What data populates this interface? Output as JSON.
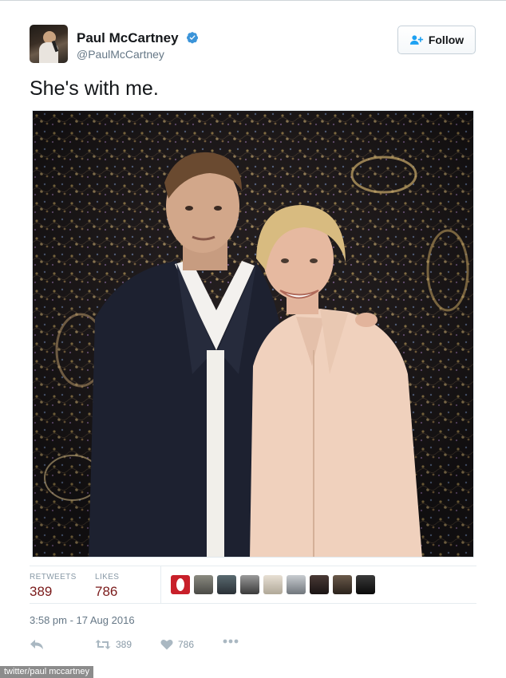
{
  "author": {
    "name": "Paul McCartney",
    "handle": "@PaulMcCartney",
    "verified_icon": "verified-badge-icon",
    "verified_color": "#3b94d9"
  },
  "follow": {
    "label": "Follow",
    "icon": "add-user-icon"
  },
  "tweet": {
    "text": "She's with me."
  },
  "stats": {
    "retweets_label": "RETWEETS",
    "retweets_value": "389",
    "likes_label": "LIKES",
    "likes_value": "786",
    "value_color": "#7a1a1a"
  },
  "likers": [
    {
      "name": "liker-avatar-1"
    },
    {
      "name": "liker-avatar-2"
    },
    {
      "name": "liker-avatar-3"
    },
    {
      "name": "liker-avatar-4"
    },
    {
      "name": "liker-avatar-5"
    },
    {
      "name": "liker-avatar-6"
    },
    {
      "name": "liker-avatar-7"
    },
    {
      "name": "liker-avatar-8"
    },
    {
      "name": "liker-avatar-9"
    }
  ],
  "timestamp": "3:58 pm - 17 Aug 2016",
  "actions": {
    "reply_icon": "reply-icon",
    "retweet_icon": "retweet-icon",
    "retweet_count": "389",
    "like_icon": "heart-icon",
    "like_count": "786",
    "more_icon": "more-icon"
  },
  "credit": "twitter/paul mccartney"
}
